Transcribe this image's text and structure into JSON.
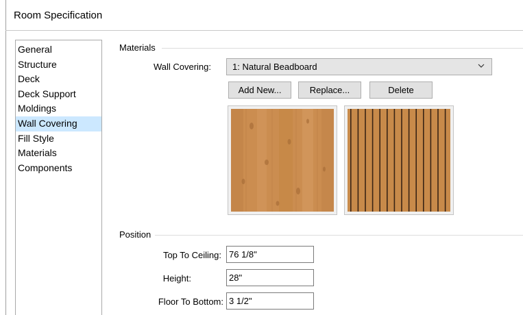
{
  "window": {
    "title": "Room Specification"
  },
  "sidebar": {
    "items": [
      {
        "label": "General"
      },
      {
        "label": "Structure"
      },
      {
        "label": "Deck"
      },
      {
        "label": "Deck Support"
      },
      {
        "label": "Moldings"
      },
      {
        "label": "Wall Covering",
        "selected": true
      },
      {
        "label": "Fill Style"
      },
      {
        "label": "Materials"
      },
      {
        "label": "Components"
      }
    ]
  },
  "materials": {
    "group_label": "Materials",
    "wall_covering_label": "Wall Covering:",
    "wall_covering_value": "1: Natural Beadboard",
    "add_new_label": "Add New...",
    "replace_label": "Replace...",
    "delete_label": "Delete"
  },
  "position": {
    "group_label": "Position",
    "top_to_ceiling_label": "Top To Ceiling:",
    "top_to_ceiling_value": "76 1/8\"",
    "height_label": "Height:",
    "height_value": "28\"",
    "floor_to_bottom_label": "Floor To Bottom:",
    "floor_to_bottom_value": "3 1/2\""
  },
  "colors": {
    "selected_item_bg": "#cce8ff",
    "wood": "#c88a4a",
    "wood_dark": "#3a2415"
  }
}
